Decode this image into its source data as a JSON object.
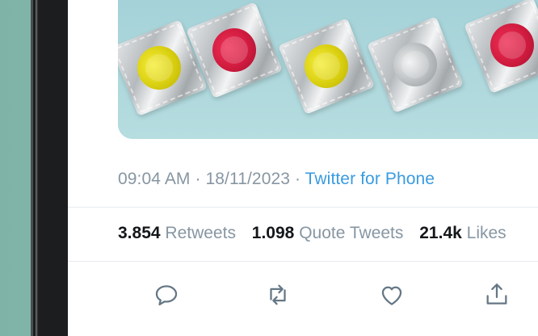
{
  "tweet": {
    "meta": {
      "time": "09:04 AM",
      "separator": " · ",
      "date": "18/11/2023",
      "source": "Twitter for Phone"
    },
    "stats": [
      {
        "value": "3.854",
        "label": "Retweets"
      },
      {
        "value": "1.098",
        "label": "Quote Tweets"
      },
      {
        "value": "21.4k",
        "label": "Likes"
      }
    ],
    "actions": [
      {
        "icon": "reply-icon"
      },
      {
        "icon": "retweet-icon"
      },
      {
        "icon": "like-icon"
      },
      {
        "icon": "share-icon"
      }
    ]
  },
  "colors": {
    "meta_text": "#8796a2",
    "source_link": "#3a9be0",
    "stat_number": "#14171a",
    "icon": "#657786"
  }
}
